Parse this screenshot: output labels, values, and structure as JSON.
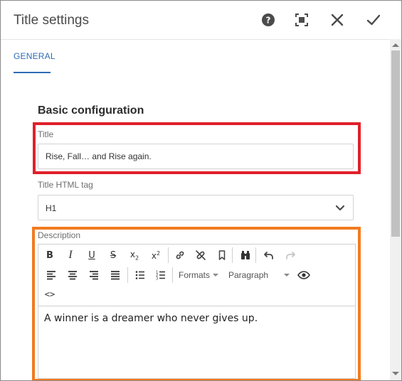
{
  "dialog": {
    "title": "Title settings"
  },
  "tabs": [
    {
      "label": "GENERAL",
      "active": true
    }
  ],
  "section": {
    "title": "Basic configuration"
  },
  "fields": {
    "title": {
      "label": "Title",
      "value": "Rise, Fall… and Rise again."
    },
    "html_tag": {
      "label": "Title HTML tag",
      "selected": "H1"
    },
    "description": {
      "label": "Description",
      "content": "A winner is a dreamer who never gives up."
    }
  },
  "toolbar": {
    "formats_label": "Formats",
    "paragraph_label": "Paragraph",
    "source_label": "<>"
  },
  "colors": {
    "accent": "#2d6bb5",
    "highlight_title": "#e0202b",
    "highlight_description": "#f27b20"
  }
}
